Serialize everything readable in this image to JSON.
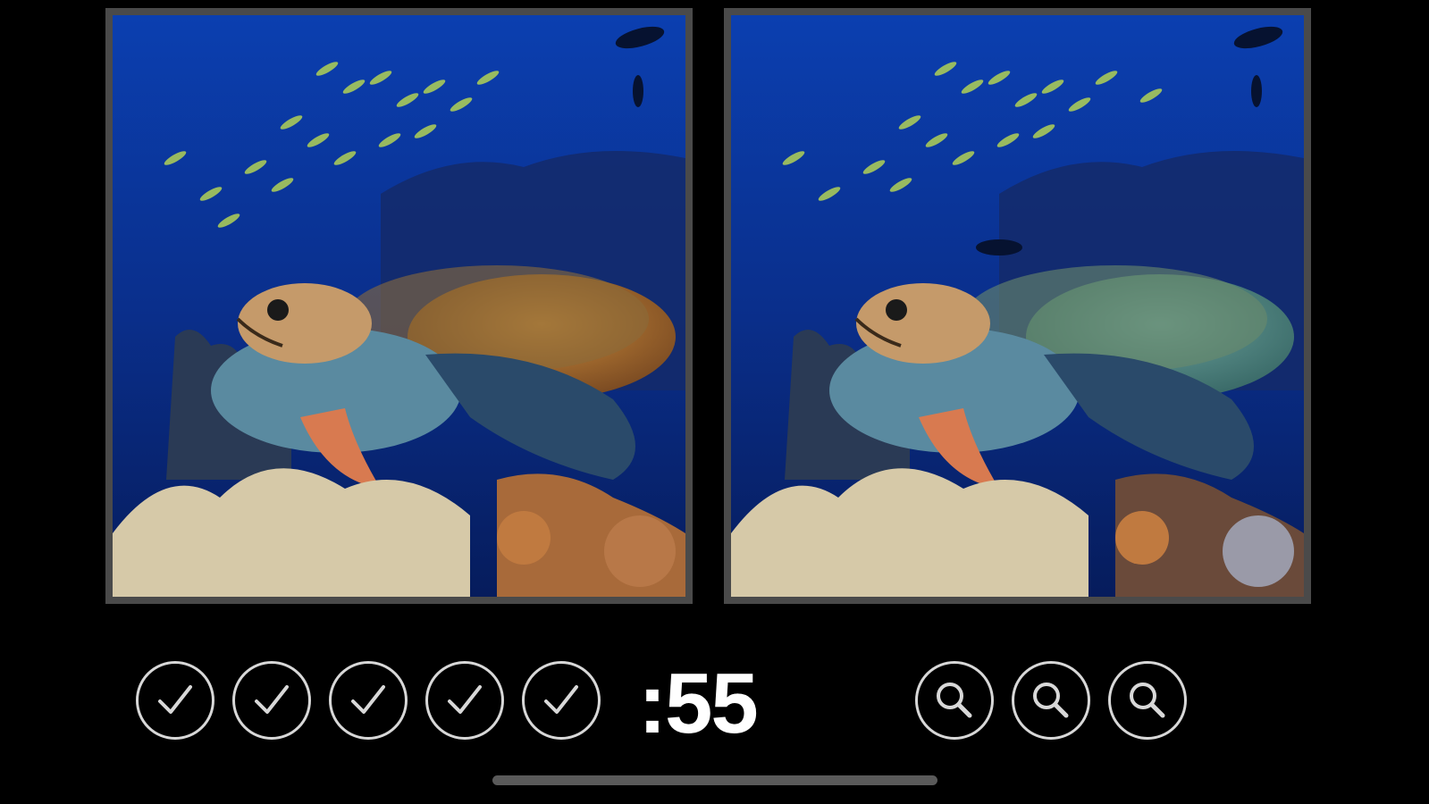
{
  "game": {
    "timer": ":55",
    "found": [
      {
        "icon": "checkmark-icon",
        "found": true
      },
      {
        "icon": "checkmark-icon",
        "found": true
      },
      {
        "icon": "checkmark-icon",
        "found": true
      },
      {
        "icon": "checkmark-icon",
        "found": true
      },
      {
        "icon": "checkmark-icon",
        "found": true
      }
    ],
    "hints": [
      {
        "icon": "magnifier-icon"
      },
      {
        "icon": "magnifier-icon"
      },
      {
        "icon": "magnifier-icon"
      }
    ]
  },
  "colors": {
    "background": "#000000",
    "frame": "#4a4a4a",
    "ring": "#d8d8d8",
    "timer_text": "#ffffff",
    "water": "#0a2a78"
  }
}
